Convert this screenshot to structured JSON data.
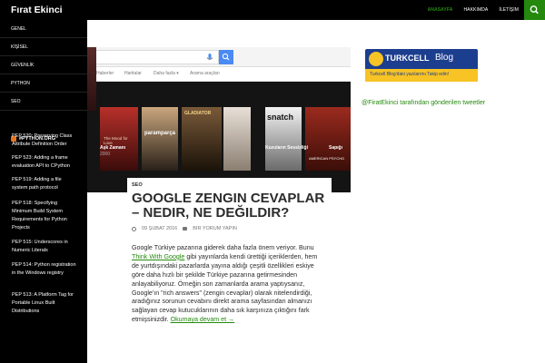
{
  "site": {
    "title": "Fırat Ekinci"
  },
  "topnav": [
    {
      "label": "ANASAYFA",
      "active": true
    },
    {
      "label": "HAKKIMDA",
      "active": false
    },
    {
      "label": "İLETİŞİM",
      "active": false
    }
  ],
  "sidebar": {
    "categories": [
      "GENEL",
      "KİŞİSEL",
      "GÜVENLİK",
      "PYTHON",
      "SEO"
    ],
    "widget_title": "#PYTHON.ORG",
    "feed": [
      "PEP 520: Preserving Class Attribute Definition Order",
      "PEP 523: Adding a frame evaluation API to CPython",
      "PEP 519: Adding a file system path protocol",
      "PEP 518: Specifying Minimum Build System Requirements for Python Projects",
      "PEP 515: Underscores in Numeric Literals",
      "PEP 514: Python registration in the Windows registry",
      "PEP 513: A Platform Tag for Portable Linux Built Distributions"
    ]
  },
  "screenshot": {
    "tabs": [
      "Haberler",
      "Haritalar",
      "Daha fazla ▾",
      "Arama araçları"
    ],
    "posters": [
      "The Mood for Love",
      "paramparça",
      "GLADIATOR",
      "",
      "snatch",
      "",
      "AMERICAN PSYCHO"
    ],
    "captions": [
      "Aşk Zamanı",
      "2000",
      "Kuzuların Sessizliği",
      "Sapığı"
    ]
  },
  "post": {
    "category": "SEO",
    "title": "GOOGLE ZENGIN CEVAPLAR – NEDIR, NE DEĞILDIR?",
    "date": "09 ŞUBAT 2016",
    "comments": "BIR YORUM YAPIN",
    "body_1": "Google Türkiye pazarına giderek daha fazla önem veriyor. Bunu ",
    "body_link": "Think With Google",
    "body_2": " gibi yayınlarda kendi ürettiği içeriklerden, hem de yurtdışındaki pazarlarda yayına aldığı çeşitli özellikleri eskiye göre daha hızlı bir şekilde Türkiye pazarına getirmesinden anlayabiliyoruz. Örneğin son zamanlarda arama yaptıysanız, Google'ın \"rich answers\" (zengin cevaplar) olarak nitelendirdiği, aradığınız sorunun cevabını direkt arama sayfasından almanızı sağlayan cevap kutucuklarının daha sık karşınıza çıktığını fark etmişsinizdir. ",
    "read_more": "Okumaya devam et →"
  },
  "right": {
    "banner_brand": "TURKCELL",
    "banner_word": "Blog",
    "banner_sub": "Turkcell Blog'daki yazılarımı Takip edin!",
    "tweets_link": "@FiratEkinci tarafından gönderilen tweetler"
  },
  "colors": {
    "accent": "#24890d",
    "dark": "#000000",
    "banner": "#1c3e8e"
  }
}
